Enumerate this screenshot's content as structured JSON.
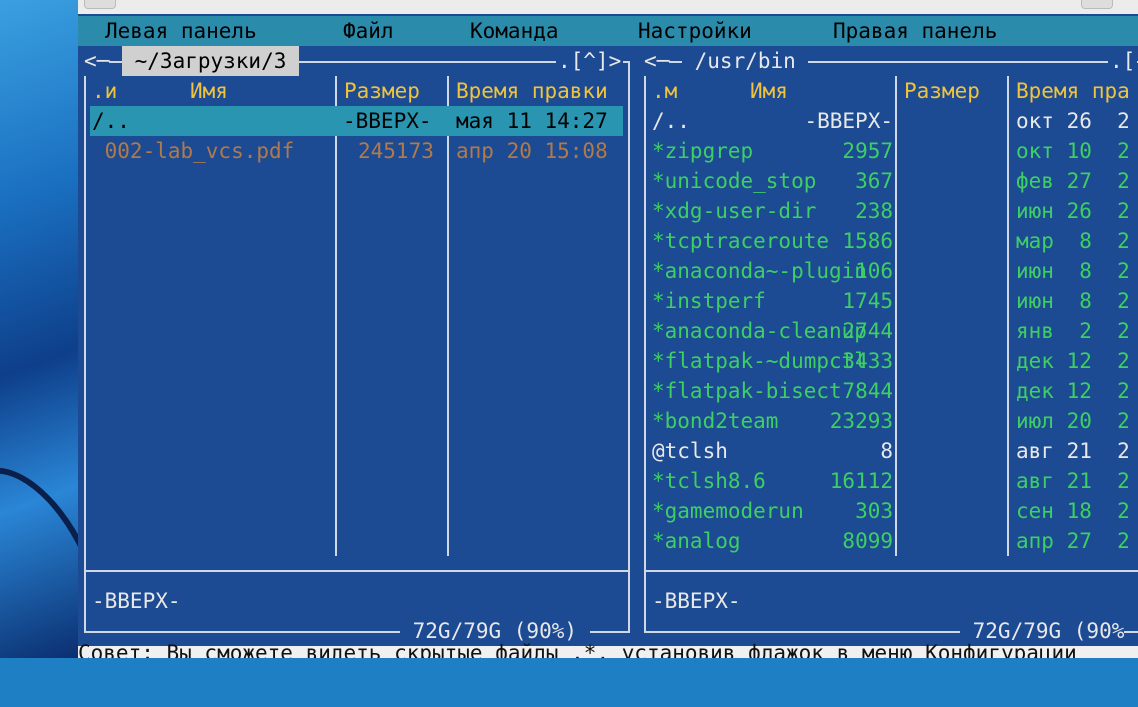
{
  "menu": [
    "Левая панель",
    "Файл",
    "Команда",
    "Настройки",
    "Правая панель"
  ],
  "left_panel": {
    "path_prefix": "<─",
    "path": " ~/Загрузки/3 ",
    "path_suffix": ".[^]>",
    "headers": {
      "name_prefix": ".и",
      "name": "Имя",
      "size": "Размер",
      "mtime": "Время правки"
    },
    "rows": [
      {
        "name": "/..",
        "size": "-ВВЕРХ-",
        "mtime": "мая 11 14:27",
        "selected": true,
        "kind": "dir"
      },
      {
        "name": " 002-lab_vcs.pdf",
        "size": "245173",
        "mtime": "апр 20 15:08",
        "selected": false,
        "kind": "file"
      }
    ],
    "status": "-ВВЕРХ-",
    "disk": " 72G/79G (90%) "
  },
  "right_panel": {
    "path_prefix": "<─",
    "path": " /usr/bin ",
    "path_suffix": ".[",
    "headers": {
      "name_prefix": ".м",
      "name": "Имя",
      "size": "Размер",
      "mtime": "Время пра"
    },
    "rows": [
      {
        "name": "/..",
        "size": "-ВВЕРХ-",
        "mtime": "окт 26  2",
        "kind": "dir"
      },
      {
        "name": "*zipgrep",
        "size": "2957",
        "mtime": "окт 10  2",
        "kind": "exec"
      },
      {
        "name": "*unicode_stop",
        "size": "367",
        "mtime": "фев 27  2",
        "kind": "exec"
      },
      {
        "name": "*xdg-user-dir",
        "size": "238",
        "mtime": "июн 26  2",
        "kind": "exec"
      },
      {
        "name": "*tcptraceroute",
        "size": "1586",
        "mtime": "мар  8  2",
        "kind": "exec"
      },
      {
        "name": "*anaconda~-plugin",
        "size": "106",
        "mtime": "июн  8  2",
        "kind": "exec"
      },
      {
        "name": "*instperf",
        "size": "1745",
        "mtime": "июн  8  2",
        "kind": "exec"
      },
      {
        "name": "*anaconda-cleanup",
        "size": "2744",
        "mtime": "янв  2  2",
        "kind": "exec"
      },
      {
        "name": "*flatpak-~dumpctl",
        "size": "3433",
        "mtime": "дек 12  2",
        "kind": "exec"
      },
      {
        "name": "*flatpak-bisect",
        "size": "7844",
        "mtime": "дек 12  2",
        "kind": "exec"
      },
      {
        "name": "*bond2team",
        "size": "23293",
        "mtime": "июл 20  2",
        "kind": "exec"
      },
      {
        "name": "@tclsh",
        "size": "8",
        "mtime": "авг 21  2",
        "kind": "link"
      },
      {
        "name": "*tclsh8.6",
        "size": "16112",
        "mtime": "авг 21  2",
        "kind": "exec"
      },
      {
        "name": "*gamemoderun",
        "size": "303",
        "mtime": "сен 18  2",
        "kind": "exec"
      },
      {
        "name": "*analog",
        "size": "8099",
        "mtime": "апр 27  2",
        "kind": "exec"
      }
    ],
    "status": "-ВВЕРХ-",
    "disk": " 72G/79G (90%"
  },
  "hint": "Совет: Вы сможете видеть скрытые файлы .*, установив флажок в меню Конфигурации"
}
